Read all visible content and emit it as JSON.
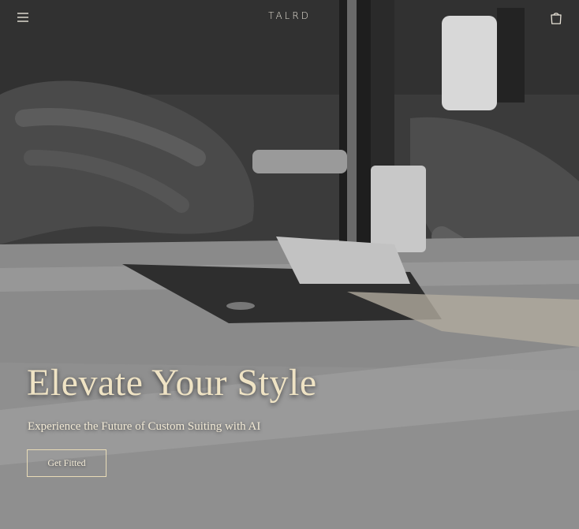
{
  "header": {
    "brand": "TALRD",
    "menu_icon": "hamburger-menu-icon",
    "cart_icon": "shopping-bag-icon"
  },
  "hero": {
    "headline": "Elevate Your Style",
    "subheadline": "Experience the Future of Custom Suiting with AI",
    "cta_label": "Get Fitted",
    "background_image": "sewing-machine-photo"
  },
  "colors": {
    "headline": "#efe3c4",
    "accent_border": "#e9dcb7",
    "brand_text": "#e8e3d8"
  }
}
